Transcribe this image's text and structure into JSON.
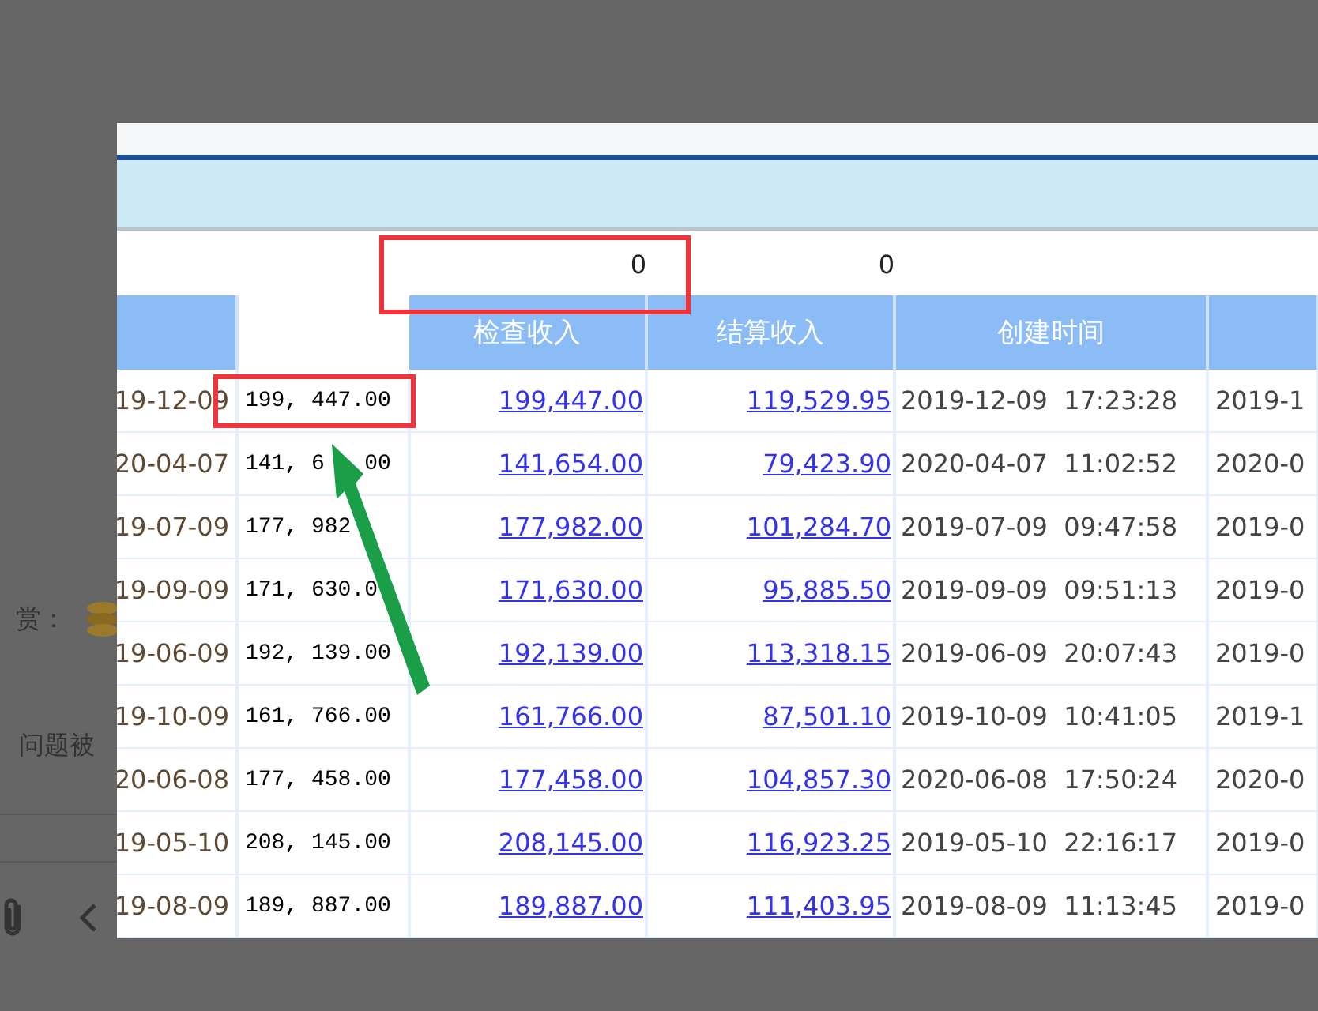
{
  "background_page": {
    "reward_label": "赏：",
    "notice_text": "问题被"
  },
  "dialog": {
    "totals": {
      "inspection_income": "0",
      "settlement_income": "0"
    },
    "columns": [
      {
        "kind": "blue"
      },
      {
        "kind": "blank"
      },
      {
        "kind": "blue",
        "label": "检查收入"
      },
      {
        "kind": "blue",
        "label": "结算收入"
      },
      {
        "kind": "blue",
        "label": "创建时间"
      },
      {
        "kind": "blue"
      }
    ],
    "rows": [
      {
        "column_1": "19-12-09",
        "column_2": "199, 447.00",
        "inspection_income": "199,447.00",
        "settlement_income": "119,529.95",
        "created_time": "2019-12-09  17:23:28",
        "column_6": "2019-1"
      },
      {
        "column_1": "20-04-07",
        "column_2": "141, 6   00",
        "inspection_income": "141,654.00",
        "settlement_income": "79,423.90",
        "created_time": "2020-04-07  11:02:52",
        "column_6": "2020-0"
      },
      {
        "column_1": "19-07-09",
        "column_2": "177, 982",
        "inspection_income": "177,982.00",
        "settlement_income": "101,284.70",
        "created_time": "2019-07-09  09:47:58",
        "column_6": "2019-0"
      },
      {
        "column_1": "19-09-09",
        "column_2": "171, 630.0",
        "inspection_income": "171,630.00",
        "settlement_income": "95,885.50",
        "created_time": "2019-09-09  09:51:13",
        "column_6": "2019-0"
      },
      {
        "column_1": "19-06-09",
        "column_2": "192, 139.00",
        "inspection_income": "192,139.00",
        "settlement_income": "113,318.15",
        "created_time": "2019-06-09  20:07:43",
        "column_6": "2019-0"
      },
      {
        "column_1": "19-10-09",
        "column_2": "161, 766.00",
        "inspection_income": "161,766.00",
        "settlement_income": "87,501.10",
        "created_time": "2019-10-09  10:41:05",
        "column_6": "2019-1"
      },
      {
        "column_1": "20-06-08",
        "column_2": "177, 458.00",
        "inspection_income": "177,458.00",
        "settlement_income": "104,857.30",
        "created_time": "2020-06-08  17:50:24",
        "column_6": "2020-0"
      },
      {
        "column_1": "19-05-10",
        "column_2": "208, 145.00",
        "inspection_income": "208,145.00",
        "settlement_income": "116,923.25",
        "created_time": "2019-05-10  22:16:17",
        "column_6": "2019-0"
      },
      {
        "column_1": "19-08-09",
        "column_2": "189, 887.00",
        "inspection_income": "189,887.00",
        "settlement_income": "111,403.95",
        "created_time": "2019-08-09  11:13:45",
        "column_6": "2019-0"
      }
    ]
  }
}
